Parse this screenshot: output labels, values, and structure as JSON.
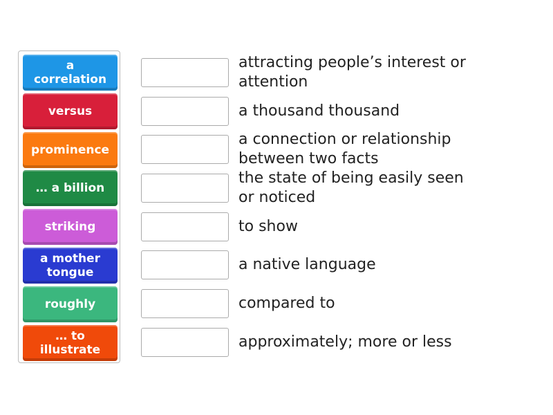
{
  "tiles": [
    {
      "label": "a correlation",
      "color": "#1e96e6"
    },
    {
      "label": "versus",
      "color": "#d81f3a"
    },
    {
      "label": "prominence",
      "color": "#fb7a10"
    },
    {
      "label": "… a billion",
      "color": "#1f8a45"
    },
    {
      "label": "striking",
      "color": "#cc5cd8"
    },
    {
      "label": "a mother tongue",
      "color": "#2a3bd1"
    },
    {
      "label": "roughly",
      "color": "#3bb77e"
    },
    {
      "label": "… to illustrate",
      "color": "#f04a0a"
    }
  ],
  "definitions": [
    "attracting people’s interest or attention",
    "a thousand thousand",
    "a connection or relationship between two facts",
    "the state of being easily seen or noticed",
    "to show",
    "a native language",
    "compared to",
    "approximately; more or less"
  ]
}
